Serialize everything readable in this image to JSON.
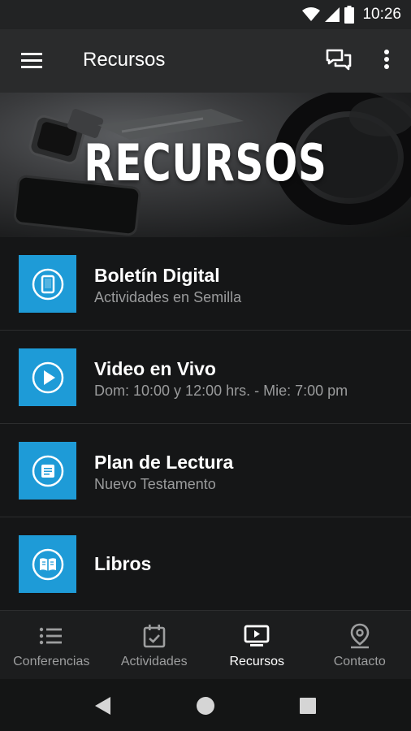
{
  "status_bar": {
    "time": "10:26"
  },
  "app_bar": {
    "title": "Recursos"
  },
  "hero": {
    "title": "RECURSOS"
  },
  "items": [
    {
      "title": "Boletín Digital",
      "subtitle": "Actividades en Semilla",
      "icon": "tablet-icon"
    },
    {
      "title": "Video en Vivo",
      "subtitle": "Dom: 10:00 y 12:00 hrs. - Mie: 7:00 pm",
      "icon": "play-icon"
    },
    {
      "title": "Plan de Lectura",
      "subtitle": "Nuevo Testamento",
      "icon": "document-icon"
    },
    {
      "title": "Libros",
      "subtitle": "",
      "icon": "book-icon"
    }
  ],
  "bottom_nav": [
    {
      "label": "Conferencias",
      "icon": "list-icon"
    },
    {
      "label": "Actividades",
      "icon": "calendar-check-icon"
    },
    {
      "label": "Recursos",
      "icon": "tv-play-icon",
      "active": true
    },
    {
      "label": "Contacto",
      "icon": "location-pin-icon"
    }
  ],
  "colors": {
    "accent": "#1e9bd7",
    "background": "#151617",
    "app_bar": "#2a2b2c"
  }
}
